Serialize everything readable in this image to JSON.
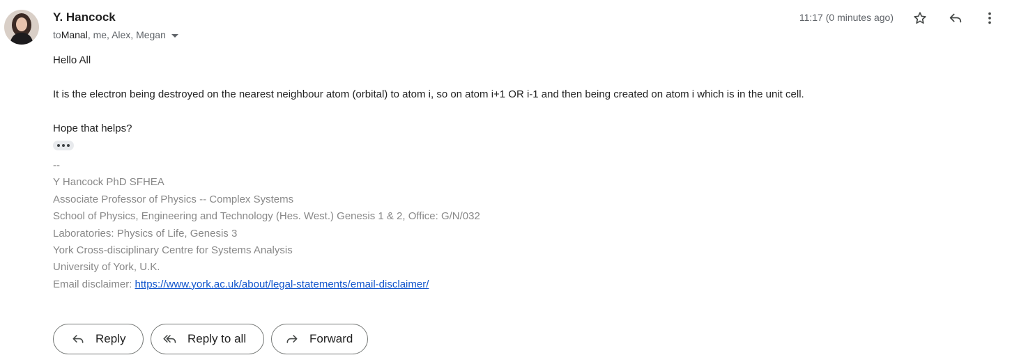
{
  "sender": {
    "name": "Y. Hancock",
    "to_prefix": "to ",
    "to_first": "Manal",
    "to_rest": ", me, Alex, Megan",
    "timestamp": "11:17 (0 minutes ago)"
  },
  "icons": {
    "avatar": "avatar-photo",
    "star": "star-icon",
    "reply": "reply-icon",
    "more": "more-vert-icon",
    "expand": "chevron-down-icon"
  },
  "body": {
    "greeting": "Hello All",
    "paragraph": "It is the electron being destroyed on the nearest neighbour atom (orbital) to atom i, so on atom i+1 OR i-1 and then being created on atom i which is in the unit cell.",
    "closing": "Hope that helps?"
  },
  "signature": {
    "separator": "--",
    "line1": "Y Hancock PhD SFHEA",
    "line2": "Associate Professor of Physics -- Complex Systems",
    "line3": "School of Physics, Engineering and Technology (Hes. West.) Genesis 1 & 2, Office: G/N/032",
    "line4": "Laboratories: Physics of Life, Genesis 3",
    "line5": "York Cross-disciplinary Centre for Systems Analysis",
    "line6": "University of York, U.K.",
    "disclaimer_label": "Email disclaimer: ",
    "disclaimer_link": "https://www.york.ac.uk/about/legal-statements/email-disclaimer/"
  },
  "actions": {
    "reply": "Reply",
    "reply_all": "Reply to all",
    "forward": "Forward"
  },
  "colors": {
    "link": "#1155cc",
    "signature_text": "#888888"
  }
}
